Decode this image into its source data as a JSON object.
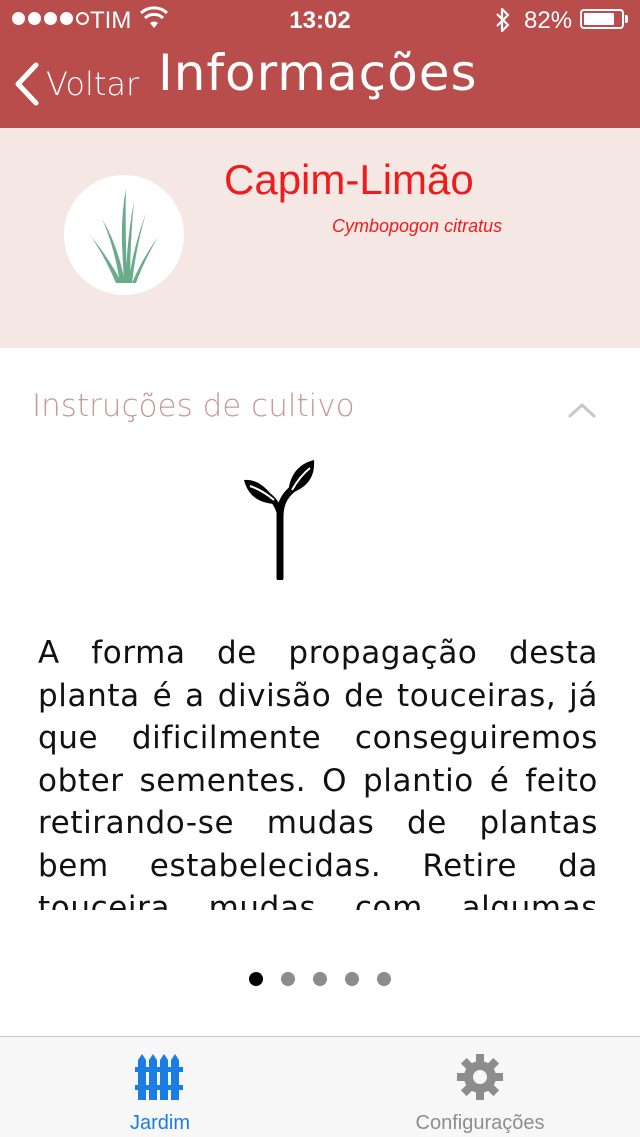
{
  "status_bar": {
    "carrier": "TIM",
    "time": "13:02",
    "battery_percent": "82%",
    "battery_level": 0.82,
    "signal_bars_filled": 4,
    "signal_bars_total": 5
  },
  "nav": {
    "back_label": "Voltar",
    "title": "Informações",
    "bar_color": "#b84d4b"
  },
  "plant": {
    "name": "Capim-Limão",
    "scientific_name": "Cymbopogon citratus",
    "icon": "grass-icon"
  },
  "section": {
    "title": "Instruções de cultivo",
    "collapse_icon": "chevron-up-icon",
    "illustration_icon": "sprout-icon",
    "text": "A forma de propagação desta planta é a divisão de touceiras, já que dificilmente conseguiremos obter sementes. O plantio é feito retirando-se mudas de plantas bem estabelecidas. Retire da touceira mudas com algumas raízes"
  },
  "pager": {
    "total_pages": 5,
    "current_page": 1
  },
  "tabbar": {
    "tabs": [
      {
        "label": "Jardim",
        "icon": "fence-icon",
        "selected": true,
        "color": "#1a7de3"
      },
      {
        "label": "Configurações",
        "icon": "gear-icon",
        "selected": false,
        "color": "#8d8d8d"
      }
    ]
  }
}
